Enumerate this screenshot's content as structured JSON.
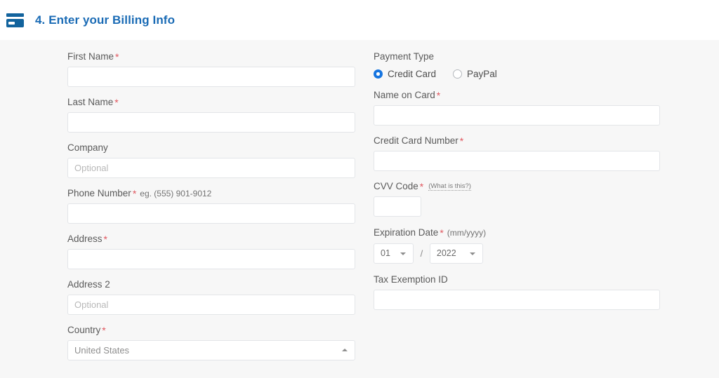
{
  "header": {
    "icon": "credit-card-icon",
    "title": "4. Enter your Billing Info",
    "title_color": "#1a6bb5"
  },
  "form": {
    "required_marker": "*",
    "left": {
      "first_name": {
        "label": "First Name",
        "required": true,
        "value": "",
        "placeholder": ""
      },
      "last_name": {
        "label": "Last Name",
        "required": true,
        "value": "",
        "placeholder": ""
      },
      "company": {
        "label": "Company",
        "required": false,
        "value": "",
        "placeholder": "Optional"
      },
      "phone_number": {
        "label": "Phone Number",
        "required": true,
        "hint": "eg. (555) 901-9012",
        "value": "",
        "placeholder": ""
      },
      "address": {
        "label": "Address",
        "required": true,
        "value": "",
        "placeholder": ""
      },
      "address2": {
        "label": "Address 2",
        "required": false,
        "value": "",
        "placeholder": "Optional"
      },
      "country": {
        "label": "Country",
        "required": true,
        "selected": "United States",
        "caret": "chevron-up-icon"
      }
    },
    "right": {
      "payment_type": {
        "label": "Payment Type",
        "required": false,
        "options": [
          {
            "label": "Credit Card",
            "selected": true
          },
          {
            "label": "PayPal",
            "selected": false
          }
        ],
        "selected_color": "#1675e0"
      },
      "name_on_card": {
        "label": "Name on Card",
        "required": true,
        "value": "",
        "placeholder": ""
      },
      "credit_card_number": {
        "label": "Credit Card Number",
        "required": true,
        "value": "",
        "placeholder": ""
      },
      "cvv_code": {
        "label": "CVV Code",
        "required": true,
        "help_link": "(What is this?)",
        "value": "",
        "placeholder": ""
      },
      "expiration_date": {
        "label": "Expiration Date",
        "required": true,
        "hint": "(mm/yyyy)",
        "separator": "/",
        "month": {
          "selected": "01",
          "caret": "chevron-down-icon"
        },
        "year": {
          "selected": "2022",
          "caret": "chevron-down-icon"
        }
      },
      "tax_exemption_id": {
        "label": "Tax Exemption ID",
        "required": false,
        "value": "",
        "placeholder": ""
      }
    }
  }
}
